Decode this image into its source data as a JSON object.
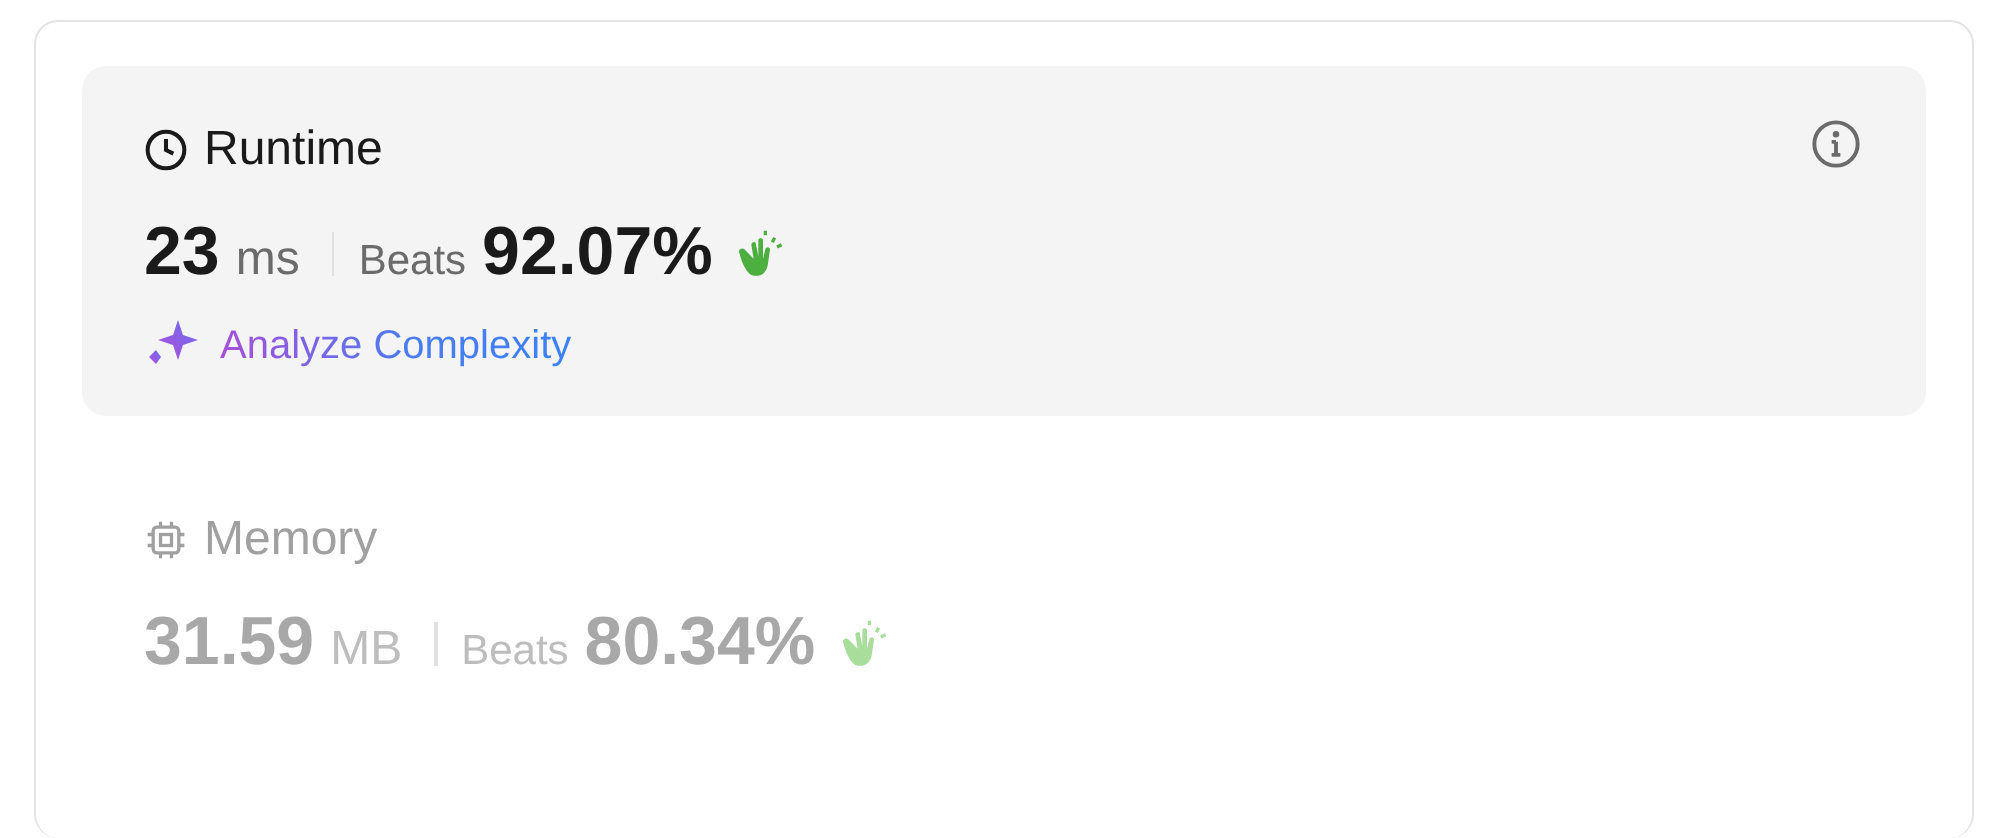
{
  "metrics": [
    {
      "kind": "runtime",
      "title": "Runtime",
      "selected": true,
      "value": "23",
      "unit": "ms",
      "beats_label": "Beats",
      "beats": "92.07%",
      "action": "Analyze Complexity"
    },
    {
      "kind": "memory",
      "title": "Memory",
      "selected": false,
      "value": "31.59",
      "unit": "MB",
      "beats_label": "Beats",
      "beats": "80.34%"
    }
  ]
}
